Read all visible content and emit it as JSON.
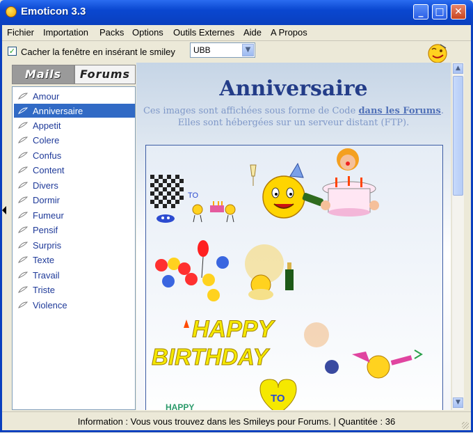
{
  "window": {
    "title": "Emoticon 3.3",
    "minimize": "_",
    "maximize": "□",
    "close": "✕"
  },
  "menu": [
    "Fichier",
    "Importation",
    "Packs",
    "Options",
    "Outils Externes",
    "Aide",
    "A Propos"
  ],
  "toolbar": {
    "checkbox_label": "Cacher la fenêtre en insérant le smiley",
    "checked": true,
    "format_value": "UBB",
    "smiley_icon": "winking-smiley-icon"
  },
  "tabs": {
    "mails": "Mails",
    "forums": "Forums",
    "active": "forums"
  },
  "categories": [
    {
      "label": "Amour",
      "selected": false
    },
    {
      "label": "Anniversaire",
      "selected": true
    },
    {
      "label": "Appetit",
      "selected": false
    },
    {
      "label": "Colere",
      "selected": false
    },
    {
      "label": "Confus",
      "selected": false
    },
    {
      "label": "Content",
      "selected": false
    },
    {
      "label": "Divers",
      "selected": false
    },
    {
      "label": "Dormir",
      "selected": false
    },
    {
      "label": "Fumeur",
      "selected": false
    },
    {
      "label": "Pensif",
      "selected": false
    },
    {
      "label": "Surpris",
      "selected": false
    },
    {
      "label": "Texte",
      "selected": false
    },
    {
      "label": "Travail",
      "selected": false
    },
    {
      "label": "Triste",
      "selected": false
    },
    {
      "label": "Violence",
      "selected": false
    }
  ],
  "content": {
    "title": "Anniversaire",
    "desc_line1_prefix": "Ces images sont affichées sous forme de Code ",
    "desc_link": "dans les Forums",
    "desc_line1_suffix": ".",
    "desc_line2": "Elles sont hébergées sur un serveur distant (FTP).",
    "to_label": "TO",
    "happy": "HAPPY",
    "birthday": "BIRTHDAY",
    "to_badge": "TO",
    "happy_partial": "HAPPY"
  },
  "status": {
    "text": "Information : Vous vous trouvez dans les Smileys pour Forums. | Quantitée : 36"
  },
  "colors": {
    "title_bar": "#0a47d0",
    "selection": "#316ac5",
    "heading": "#233c88",
    "desc": "#7f98c8"
  }
}
